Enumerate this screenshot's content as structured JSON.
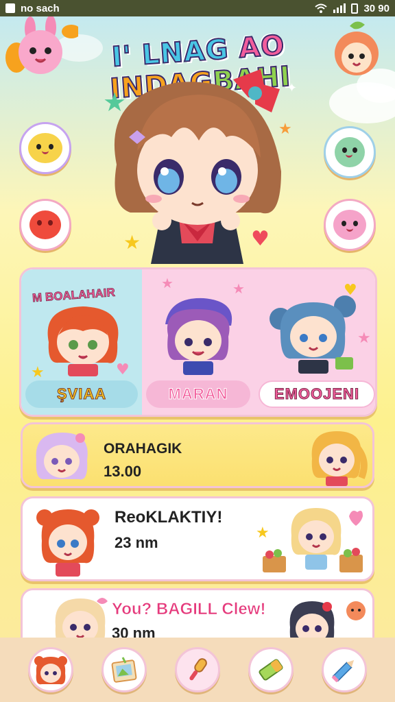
{
  "status_bar": {
    "left_text": "no sach",
    "right_text": "30 90",
    "icons": [
      "app-icon",
      "wifi-icon",
      "signal-icon",
      "battery-icon"
    ]
  },
  "app": {
    "title_parts": [
      "I' LNAG ",
      "AO ",
      "INDAG",
      "BAHI"
    ]
  },
  "categories": [
    {
      "label": "ŞVIAA",
      "top_text": "M BOALAHAIR"
    },
    {
      "label": "MARAN"
    },
    {
      "label": "EMOOJENI"
    }
  ],
  "cards": [
    {
      "name": "ORAHAGIK",
      "sub": "13.00"
    },
    {
      "name": "ReoKLAKTIY!",
      "sub": "23 nm"
    },
    {
      "name": "You? BAGILL Clew!",
      "sub": "30 nm"
    }
  ],
  "nav": {
    "items": [
      "character-avatar-icon",
      "photo-card-icon",
      "microphone-icon",
      "eraser-icon",
      "pencil-icon"
    ]
  },
  "colors": {
    "accent_pink": "#f25d9c",
    "accent_yellow": "#f7c81e",
    "accent_blue": "#49c6e5",
    "nav_bg": "#f5dcbb"
  }
}
